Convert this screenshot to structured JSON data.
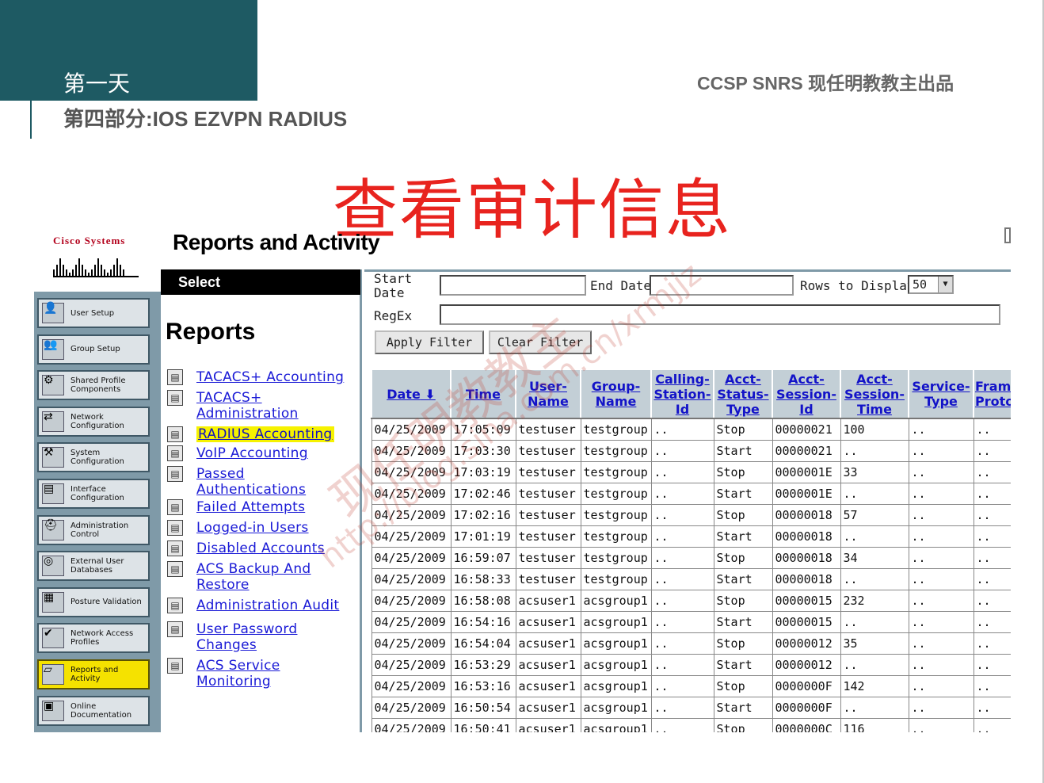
{
  "slide": {
    "day": "第一天",
    "part": "第四部分:IOS EZVPN RADIUS",
    "credit": "CCSP SNRS  现任明教教主出品",
    "title": "查看审计信息",
    "watermark_text": "现任明教教主",
    "watermark_url": "http://blog.sina.com.cn/xrmjjz"
  },
  "app": {
    "brand": "Cisco Systems",
    "page_heading": "Reports and Activity"
  },
  "nav": {
    "items": [
      {
        "label": "User Setup",
        "icon": "user-icon",
        "active": false
      },
      {
        "label": "Group Setup",
        "icon": "group-icon",
        "active": false
      },
      {
        "label": "Shared Profile Components",
        "icon": "shared-profile-icon",
        "active": false
      },
      {
        "label": "Network Configuration",
        "icon": "network-icon",
        "active": false
      },
      {
        "label": "System Configuration",
        "icon": "system-icon",
        "active": false
      },
      {
        "label": "Interface Configuration",
        "icon": "interface-icon",
        "active": false
      },
      {
        "label": "Administration Control",
        "icon": "admin-icon",
        "active": false
      },
      {
        "label": "External User Databases",
        "icon": "database-icon",
        "active": false
      },
      {
        "label": "Posture Validation",
        "icon": "posture-icon",
        "active": false
      },
      {
        "label": "Network Access Profiles",
        "icon": "network-access-icon",
        "active": false
      },
      {
        "label": "Reports and Activity",
        "icon": "reports-icon",
        "active": true
      },
      {
        "label": "Online Documentation",
        "icon": "documentation-icon",
        "active": false
      }
    ]
  },
  "select_panel": {
    "bar_label": "Select",
    "heading": "Reports",
    "items": [
      {
        "label": "TACACS+ Accounting",
        "icon": "document-icon",
        "highlighted": false
      },
      {
        "label": "TACACS+ Administration",
        "icon": "document-search-icon",
        "highlighted": false
      },
      {
        "label": "RADIUS Accounting",
        "icon": "document-icon",
        "highlighted": true
      },
      {
        "label": "VoIP Accounting",
        "icon": "document-icon",
        "highlighted": false
      },
      {
        "label": "Passed Authentications",
        "icon": "document-icon",
        "highlighted": false
      },
      {
        "label": "Failed Attempts",
        "icon": "failed-icon",
        "highlighted": false
      },
      {
        "label": "Logged-in Users",
        "icon": "users-icon",
        "highlighted": false
      },
      {
        "label": "Disabled Accounts",
        "icon": "disabled-account-icon",
        "highlighted": false
      },
      {
        "label": "ACS Backup And Restore",
        "icon": "backup-icon",
        "highlighted": false
      },
      {
        "label": "Administration Audit",
        "icon": "audit-icon",
        "highlighted": false
      },
      {
        "label": "User Password Changes",
        "icon": "password-icon",
        "highlighted": false
      },
      {
        "label": "ACS Service Monitoring",
        "icon": "monitoring-icon",
        "highlighted": false
      }
    ]
  },
  "filter": {
    "start_date_label": "Start Date",
    "start_date_value": "",
    "end_date_label": "End Date",
    "end_date_value": "",
    "rows_label": "Rows to Display",
    "rows_value": "50",
    "regex_label": "RegEx",
    "regex_value": "",
    "apply_label": "Apply Filter",
    "clear_label": "Clear Filter"
  },
  "table": {
    "columns": [
      "Date",
      "Time",
      "User-Name",
      "Group-Name",
      "Calling-Station-Id",
      "Acct-Status-Type",
      "Acct-Session-Id",
      "Acct-Session-Time",
      "Service-Type",
      "Framed-Protocol"
    ],
    "rows": [
      [
        "04/25/2009",
        "17:05:09",
        "testuser",
        "testgroup",
        "..",
        "Stop",
        "00000021",
        "100",
        "..",
        ".."
      ],
      [
        "04/25/2009",
        "17:03:30",
        "testuser",
        "testgroup",
        "..",
        "Start",
        "00000021",
        "..",
        "..",
        ".."
      ],
      [
        "04/25/2009",
        "17:03:19",
        "testuser",
        "testgroup",
        "..",
        "Stop",
        "0000001E",
        "33",
        "..",
        ".."
      ],
      [
        "04/25/2009",
        "17:02:46",
        "testuser",
        "testgroup",
        "..",
        "Start",
        "0000001E",
        "..",
        "..",
        ".."
      ],
      [
        "04/25/2009",
        "17:02:16",
        "testuser",
        "testgroup",
        "..",
        "Stop",
        "00000018",
        "57",
        "..",
        ".."
      ],
      [
        "04/25/2009",
        "17:01:19",
        "testuser",
        "testgroup",
        "..",
        "Start",
        "00000018",
        "..",
        "..",
        ".."
      ],
      [
        "04/25/2009",
        "16:59:07",
        "testuser",
        "testgroup",
        "..",
        "Stop",
        "00000018",
        "34",
        "..",
        ".."
      ],
      [
        "04/25/2009",
        "16:58:33",
        "testuser",
        "testgroup",
        "..",
        "Start",
        "00000018",
        "..",
        "..",
        ".."
      ],
      [
        "04/25/2009",
        "16:58:08",
        "acsuser1",
        "acsgroup1",
        "..",
        "Stop",
        "00000015",
        "232",
        "..",
        ".."
      ],
      [
        "04/25/2009",
        "16:54:16",
        "acsuser1",
        "acsgroup1",
        "..",
        "Start",
        "00000015",
        "..",
        "..",
        ".."
      ],
      [
        "04/25/2009",
        "16:54:04",
        "acsuser1",
        "acsgroup1",
        "..",
        "Stop",
        "00000012",
        "35",
        "..",
        ".."
      ],
      [
        "04/25/2009",
        "16:53:29",
        "acsuser1",
        "acsgroup1",
        "..",
        "Start",
        "00000012",
        "..",
        "..",
        ".."
      ],
      [
        "04/25/2009",
        "16:53:16",
        "acsuser1",
        "acsgroup1",
        "..",
        "Stop",
        "0000000F",
        "142",
        "..",
        ".."
      ],
      [
        "04/25/2009",
        "16:50:54",
        "acsuser1",
        "acsgroup1",
        "..",
        "Start",
        "0000000F",
        "..",
        "..",
        ".."
      ],
      [
        "04/25/2009",
        "16:50:41",
        "acsuser1",
        "acsgroup1",
        "..",
        "Stop",
        "0000000C",
        "116",
        "..",
        ".."
      ]
    ]
  },
  "colors": {
    "teal": "#1e5a63",
    "title_red": "#e8231e",
    "nav_bg": "#7f9aa8",
    "highlight": "#f6f200",
    "link_blue": "#1a1ad6"
  }
}
